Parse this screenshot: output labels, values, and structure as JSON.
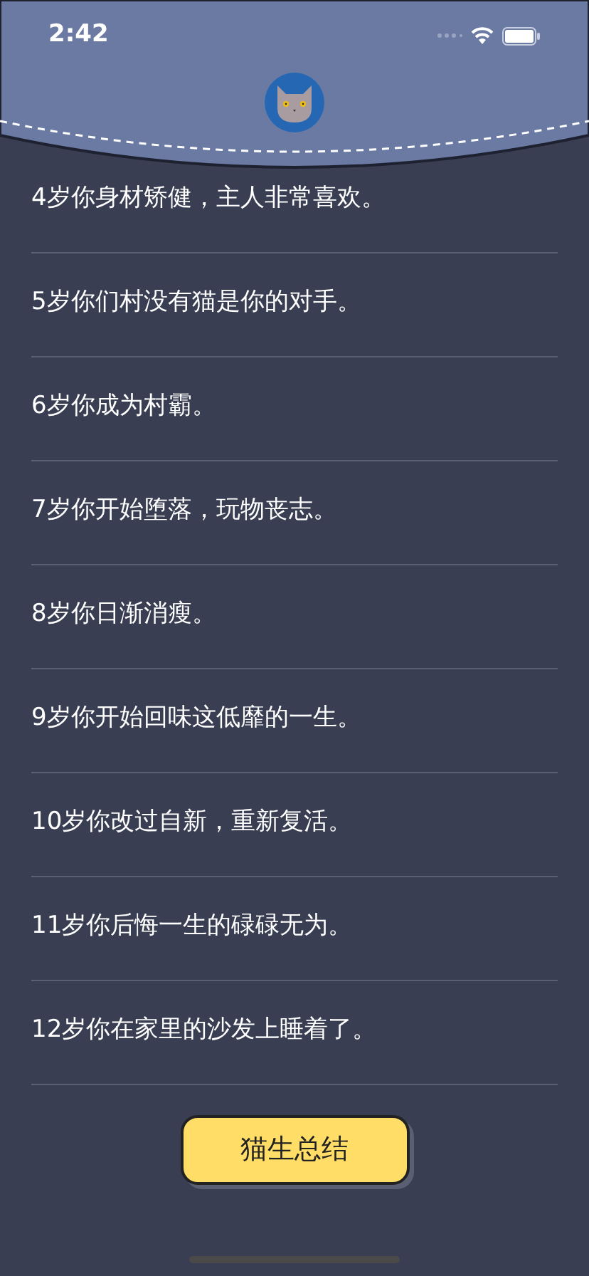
{
  "status_bar": {
    "time": "2:42"
  },
  "entries": [
    "4岁你身材矫健，主人非常喜欢。",
    "5岁你们村没有猫是你的对手。",
    "6岁你成为村霸。",
    "7岁你开始堕落，玩物丧志。",
    "8岁你日渐消瘦。",
    "9岁你开始回味这低靡的一生。",
    "10岁你改过自新，重新复活。",
    "11岁你后悔一生的碌碌无为。",
    "12岁你在家里的沙发上睡着了。"
  ],
  "summary_button": {
    "label": "猫生总结"
  }
}
